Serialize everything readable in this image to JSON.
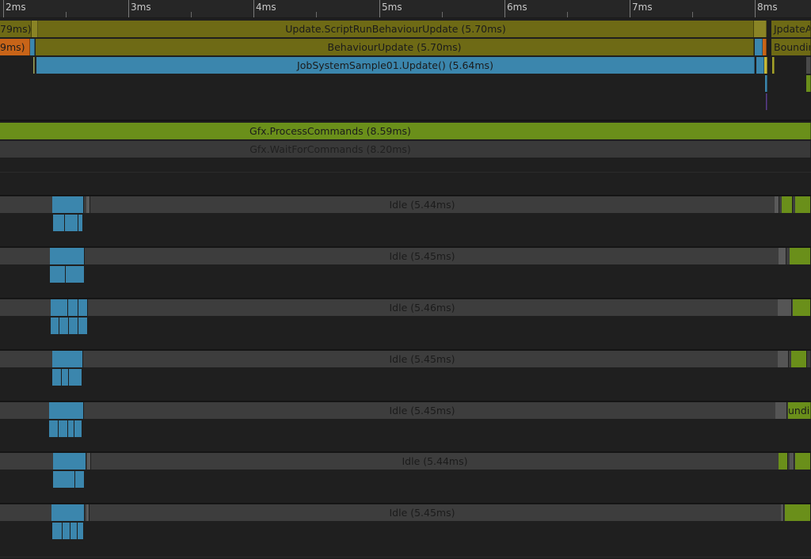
{
  "ruler": {
    "ticks": [
      "2ms",
      "3ms",
      "4ms",
      "5ms",
      "6ms",
      "7ms",
      "8ms"
    ]
  },
  "main_thread": {
    "script_update_prev": "79ms)",
    "script_update": "Update.ScriptRunBehaviourUpdate (5.70ms)",
    "script_update_next": "JpdateA",
    "behaviour_update_prev": "9ms)",
    "behaviour_update": "BehaviourUpdate (5.70ms)",
    "behaviour_update_next": "Boundin",
    "job_system_update": "JobSystemSample01.Update() (5.64ms)"
  },
  "render_thread": {
    "process_commands": "Gfx.ProcessCommands (8.59ms)",
    "wait_for_commands": "Gfx.WaitForCommands (8.20ms)"
  },
  "workers": [
    {
      "idle": "Idle (5.44ms)"
    },
    {
      "idle": "Idle (5.45ms)"
    },
    {
      "idle": "Idle (5.46ms)"
    },
    {
      "idle": "Idle (5.45ms)"
    },
    {
      "idle": "Idle (5.45ms)",
      "tail": "undin"
    },
    {
      "idle": "Idle (5.44ms)"
    },
    {
      "idle": "Idle (5.45ms)"
    }
  ],
  "colors": {
    "background": "#1e1e1e",
    "script": "#6e6a15",
    "orange": "#c86418",
    "job": "#3b86ad",
    "render": "#6a8f1a",
    "idle": "#3d3d3d"
  }
}
